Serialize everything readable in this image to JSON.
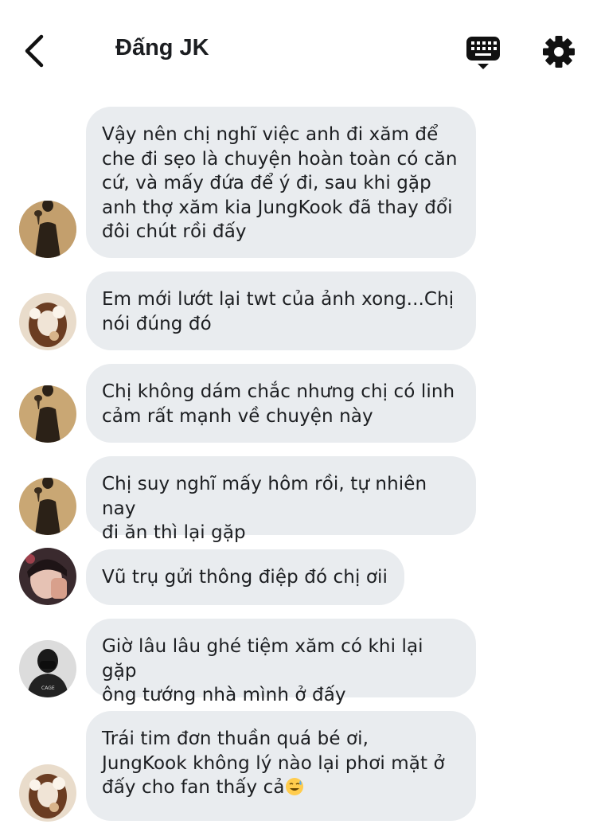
{
  "header": {
    "title": "Đấng JK"
  },
  "messages": [
    {
      "avatar": "avatar-shadow-glass",
      "text": "Vậy nên chị nghĩ việc anh đi xăm để\nche đi sẹo là chuyện hoàn toàn có căn\ncứ, và mấy đứa để ý đi, sau khi gặp\nanh thợ xăm kia JungKook đã thay đổi\nđôi chút rồi đấy"
    },
    {
      "avatar": "avatar-flower-portrait",
      "text": "Em mới lướt lại twt của ảnh xong...Chị\nnói đúng đó"
    },
    {
      "avatar": "avatar-shadow-glass",
      "text": "Chị không dám chắc nhưng chị có linh\ncảm rất mạnh về chuyện này"
    },
    {
      "avatar": "avatar-shadow-glass",
      "text": "Chị suy nghĩ mấy hôm rồi, tự nhiên nay\nđi ăn thì lại gặp"
    },
    {
      "avatar": "avatar-boy-portrait",
      "text": "Vũ trụ gửi thông điệp đó chị ơii"
    },
    {
      "avatar": "avatar-masked-person",
      "text": "Giờ lâu lâu ghé tiệm xăm có khi lại gặp\nông tướng nhà mình ở đấy"
    },
    {
      "avatar": "avatar-flower-portrait",
      "text": "Trái tim đơn thuần quá bé ơi,\nJungKook không lý nào lại phơi mặt ở\nđấy cho fan thấy cả",
      "emoji": "sweat-smile-emoji"
    }
  ],
  "colors": {
    "bubble": "#e9ecef",
    "text": "#1c1e21",
    "icon": "#111111"
  },
  "icons": [
    "back-arrow-icon",
    "keyboard-icon",
    "gear-icon",
    "sweat-smile-emoji"
  ]
}
